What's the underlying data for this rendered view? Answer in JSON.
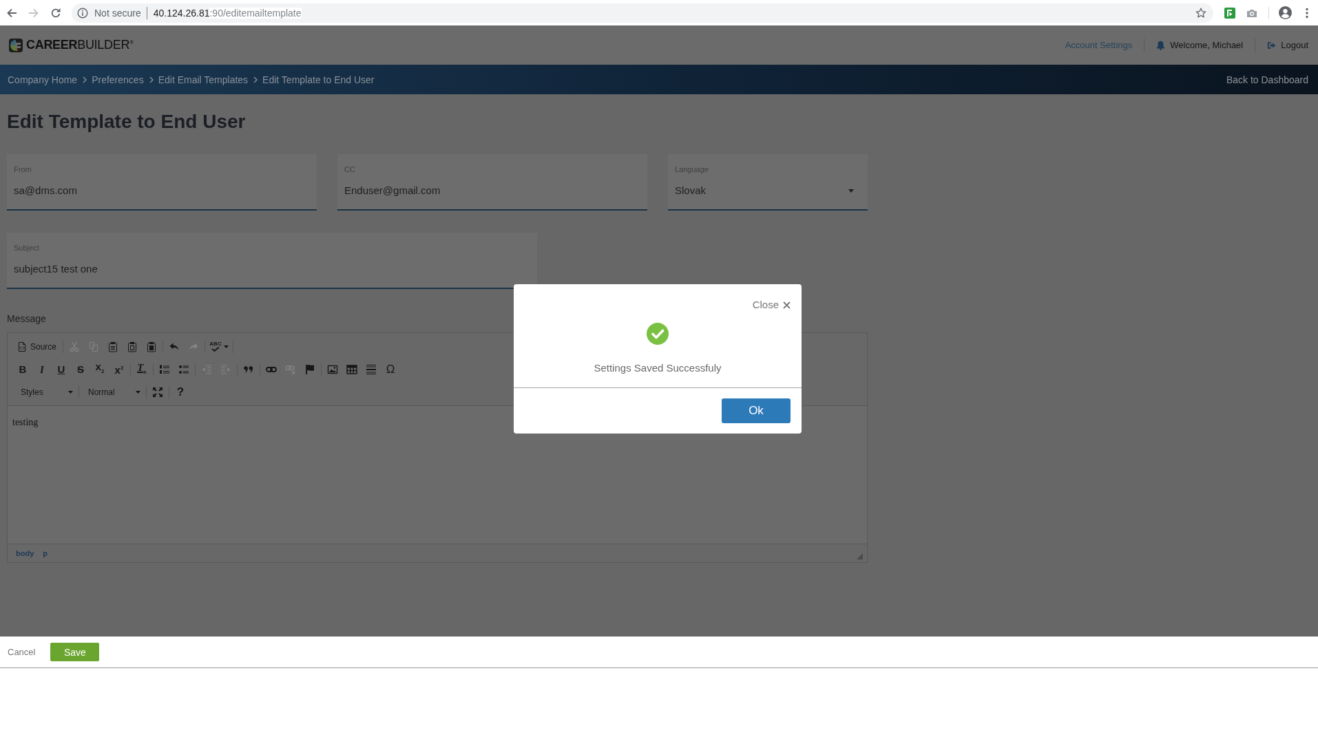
{
  "browser": {
    "nav": [
      {
        "kind": "back",
        "disabled": false
      },
      {
        "kind": "forward",
        "disabled": true
      },
      {
        "kind": "reload",
        "disabled": false
      }
    ],
    "security": "Not secure",
    "url_host": "40.124.26.81",
    "url_rest": ":90/editemailtemplate"
  },
  "header": {
    "logo": "**CAREER**BUILDER$^{®}$",
    "account_settings": "Account Settings",
    "welcome": "Welcome, Michael",
    "logout": "Logout"
  },
  "breadcrumb": {
    "items": [
      "Company Home",
      "Preferences",
      "Edit Email Templates",
      "Edit Template to End User"
    ],
    "back_link": "Back to Dashboard"
  },
  "page_title": "Edit Template to End User",
  "fields": [
    {
      "kind": "text",
      "label": "From",
      "value": "sa@dms.com"
    },
    {
      "kind": "text",
      "label": "CC",
      "value": "Enduser@gmail.com"
    },
    {
      "kind": "select",
      "label": "Language",
      "value": "Slovak"
    }
  ],
  "subject": {
    "label": "Subject",
    "value": "subject15 test one"
  },
  "message": {
    "label": "Message",
    "toolbar": [
      {
        "groups": [
          [
            {
              "kind": "source",
              "label": "Source",
              "disabled": false
            }
          ],
          [
            {
              "kind": "cut",
              "disabled": true
            },
            {
              "kind": "copy",
              "disabled": true
            },
            {
              "kind": "paste",
              "disabled": false
            },
            {
              "kind": "paste-text",
              "disabled": false
            },
            {
              "kind": "paste-word",
              "disabled": false
            }
          ],
          [
            {
              "kind": "undo",
              "disabled": false
            },
            {
              "kind": "redo",
              "disabled": true
            }
          ],
          [
            {
              "kind": "spellcheck",
              "glyph": "ABC",
              "disabled": false
            }
          ]
        ]
      },
      {
        "groups": [
          [
            {
              "kind": "bold",
              "glyph": "B",
              "disabled": false
            },
            {
              "kind": "italic",
              "glyph": "I",
              "disabled": false
            },
            {
              "kind": "underline",
              "glyph": "U",
              "disabled": false
            },
            {
              "kind": "strike",
              "glyph": "S",
              "disabled": false
            },
            {
              "kind": "subscript",
              "glyph": "x$_{2}$",
              "disabled": false
            },
            {
              "kind": "superscript",
              "glyph": "x$^{2}$",
              "disabled": false
            }
          ],
          [
            {
              "kind": "remove-format",
              "glyph": "T$_{x}$",
              "disabled": false
            }
          ],
          [
            {
              "kind": "numbered-list",
              "disabled": false
            },
            {
              "kind": "bulleted-list",
              "disabled": false
            }
          ],
          [
            {
              "kind": "outdent",
              "disabled": true
            },
            {
              "kind": "indent",
              "disabled": true
            }
          ],
          [
            {
              "kind": "blockquote",
              "disabled": false
            }
          ],
          [
            {
              "kind": "link",
              "disabled": false
            },
            {
              "kind": "unlink",
              "disabled": true
            },
            {
              "kind": "anchor",
              "disabled": false
            }
          ],
          [
            {
              "kind": "image",
              "disabled": false
            },
            {
              "kind": "table",
              "disabled": false
            },
            {
              "kind": "horizontal-rule",
              "disabled": false
            },
            {
              "kind": "special-char",
              "glyph": "Ω",
              "disabled": false
            }
          ]
        ]
      },
      {
        "groups": [
          [
            {
              "kind": "combo",
              "label": "Styles",
              "disabled": false
            }
          ],
          [
            {
              "kind": "combo",
              "label": "Normal",
              "disabled": false
            }
          ],
          [
            {
              "kind": "maximize",
              "disabled": false
            }
          ],
          [
            {
              "kind": "help",
              "glyph": "?",
              "disabled": false
            }
          ]
        ]
      }
    ],
    "content": "testing",
    "path": [
      "body",
      "p"
    ]
  },
  "modal": {
    "close_label": "Close",
    "message": "Settings Saved Successfuly",
    "ok": "Ok"
  },
  "footer": {
    "cancel": "Cancel",
    "save": "Save"
  }
}
